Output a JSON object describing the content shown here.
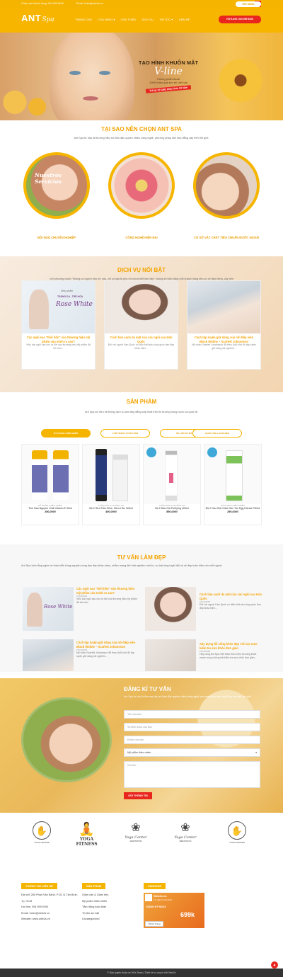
{
  "topbar": {
    "hotline_text": "Chăm sóc khách hàng: 094.999.9290",
    "email_text": "Email: hotro@web2s.vn"
  },
  "header": {
    "logo_main": "ANT",
    "logo_script": "Spa",
    "nav": [
      "TRANG CHỦ",
      "CỬA HÀNG ▾",
      "GIỚI THIỆU",
      "DỊCH VỤ",
      "TIN TỨC ▾",
      "LIÊN HỆ"
    ],
    "cart_label": "GIỎ HÀNG",
    "hotline_button": "HOTLINE: 094 999 9290"
  },
  "hero": {
    "title": "TẠO HÌNH KHUÔN MẶT",
    "script": "V-line",
    "line1": "Không phẫu thuật",
    "line2": "100% hiệu quả tức thì, trẻ hóa",
    "badge": "Trẻ lại 10 tuổi, hiệu hình 10 năm"
  },
  "why": {
    "title": "TẠI SAO NÊN CHỌN ANT SPA",
    "desc": "Ant Spa tự hào là thương hiệu số hiệu đặc quyền nhiều công nghệ, phương pháp làm đẹp đẳng cấp trên thế giới.",
    "items": [
      {
        "label": "ĐỘI NGŨ CHUYÊN NGHIỆP",
        "overlay": "Nuestros Servicios"
      },
      {
        "label": "CÔNG NGHỆ HIỆN ĐẠI"
      },
      {
        "label": "CƠ SỞ VẬT CHẤT TIÊU CHUẨN NƯỚC NGOÀI"
      }
    ]
  },
  "services": {
    "title": "DỊCH VỤ NỔI BẬT",
    "desc": "Với phương châm \"không có người phụ nữ xấu, chỉ có người phụ nữ chưa biết làm đẹp\" chúng tôi hiểu rằng mỗi khách hàng đều có vẻ đẹp riêng, vậy nên có một nhu cầu làm đẹp riêng",
    "cards": [
      {
        "title": "Các ngôi sao \"thổi hồn\" vào thương hiệu mỹ phẩm của mình ra sao?",
        "text": "Việc các ngôi sao cho ra đời các thương hiệu mỹ phẩm đã trở nên...",
        "img_line1": "Siêu phẩm",
        "img_line2": "TRẮNG DA - TRẺ HÓA",
        "img_script": "Rose White"
      },
      {
        "title": "Cách làm sạch da mặt của các ngôi sao Hàn Quốc",
        "text": "Đối với người Hàn Quốc có hiểu biết sâu rộng quốc làm đẹp khác hiện..."
      },
      {
        "title": "Cách tập luyện giữ dáng của nữ điệp viên Black Widow – Scarlett Johansson",
        "text": "Mỹ nhân Scarlett Johansson đã theo đuổi chế độ tập luyện giữ dáng rất nghiêm..."
      }
    ]
  },
  "products": {
    "title": "SẢN PHẨM",
    "desc": "Ant Spa sở hữu hệ thống dịch vụ làm đẹp đẳng cấp nhất trên thị trường trong nước và quốc tế.",
    "tabs": [
      "MỸ PHẨM THIÊN NHIÊN",
      "TẮM TRẮNG TOÀN THÂN",
      "TRỊ LIỆU DA MẶT",
      "GIẢM CÂN & GIẢM BÉO"
    ],
    "items": [
      {
        "cat": "MỸ PHẨM THIÊN NHIÊN",
        "name": "Tinh Dầu Nguyên Chất Vitamin E 30ml",
        "price": "250,000₫"
      },
      {
        "cat": "CHĂM SÓC & DƯỠNG DA",
        "name": "Bộ 2 Sữa Tắm Olive, Sữa & Bơ 400ml",
        "price": "400,000₫"
      },
      {
        "cat": "CHĂM SÓC & DƯỠNG DA",
        "name": "Bộ 2 Dầu Gội Purifying 400ml",
        "price": "550,000₫"
      },
      {
        "cat": "MỸ PHẨM THIÊN NHIÊN",
        "name": "Bộ 2 Dầu Gội Chăm Sóc Tóc Egg Extract 750ml",
        "price": "290,000₫"
      }
    ]
  },
  "advice": {
    "title": "TƯ VẤN LÀM ĐẸP",
    "desc": "Ant Spa luôn lắng nghe và thấu hiểu từng nguyện vọng làm đẹp khác nhau, nhằm mang đến trải nghiệm một tư, sự hài lòng tuyệt đối và vẻ đẹp toàn diện cho mỗi người.",
    "posts": [
      {
        "title": "Các ngôi sao \"thổi hồn\" vào thương hiệu mỹ phẩm của mình ra sao?",
        "date": "15/10/2018",
        "text": "Việc các ngôi sao cho ra đời các thương hiệu mỹ phẩm đã trở nên..."
      },
      {
        "title": "Cách làm sạch da mặt của các ngôi sao Hàn Quốc",
        "date": "15/10/2018",
        "text": "Đối với người Hàn Quốc có hiểu biết sâu rộng quốc làm đẹp khác hiện..."
      },
      {
        "title": "Cách tập luyện giữ dáng của nữ điệp viên Black Widow – Scarlett Johansson",
        "date": "15/10/2018",
        "text": "Mỹ nhân Scarlett Johansson đã theo đuổi chế độ tập luyện giữ dáng rất nghiêm..."
      },
      {
        "title": "Xây dựng lối sống khỏe đẹp với các mẹo kiểm tra sức khỏe đơn giản",
        "date": "15/10/2018",
        "text": "Hãy cùng Ant Spa Việt Nam thực hiện lối sống khỏe mạnh cùng những bài kiểm tra sức khỏe đơn giản..."
      }
    ]
  },
  "form": {
    "title": "ĐĂNG KÍ TƯ VẤN",
    "desc": "Ant Spa tự hào là thương hiệu số hiệu đặc quyền nhiều công nghệ, phương pháp làm đẹp đẳng cấp trên thế giới.",
    "name_ph": "Tên của bạn",
    "phone_ph": "Số điện thoại của bạn",
    "email_ph": "Email của bạn",
    "service_value": "Mỹ phẩm thiên nhiên",
    "note_ph": "Ghi chú",
    "submit": "GỬI THÔNG TIN"
  },
  "partners": [
    {
      "name": "YOGA CENTER",
      "icon": "hand-icon"
    },
    {
      "name": "YOGA FITNESS",
      "icon": "yoga-pose-icon"
    },
    {
      "name": "Yoga Center",
      "sub": "MEDITATION",
      "icon": "lotus-icon"
    },
    {
      "name": "Yoga Center",
      "sub": "MEDITATION",
      "icon": "lotus-icon"
    },
    {
      "name": "YOGA CENTER",
      "icon": "hand-icon"
    }
  ],
  "footer": {
    "contact_title": "THÔNG TIN LIÊN HỆ",
    "contact_lines": [
      "Địa chỉ: 265 Phan Văn Bảnh, P.15, Q.Tân Bình, Tp. HCM",
      "Hot line: 094 999 9290",
      "Email: hotro@web2s.vn",
      "Website: www.web2s.vn"
    ],
    "products_title": "SẢN PHẨM",
    "product_links": [
      "Giảm cân & Giảm béo",
      "Mỹ phẩm thiên nhiên",
      "Tắm trắng toàn thân",
      "Trị liệu da mặt",
      "Uncategorized"
    ],
    "fanpage_title": "FANPAGE",
    "fanpage_name": "Web2s.vn",
    "fanpage_likes": "1,5 nghìn lượt thích",
    "fanpage_tag": "ĐĂNG KÝ NGAY",
    "fanpage_promo": "699k",
    "fanpage_btn": "Thích Trang",
    "copyright": "© Bản quyền thuộc về W2s Team | Thiết kế và duy trì bởi Web2s"
  },
  "colors": {
    "accent": "#f5b400",
    "title": "#f5a300",
    "hotline": "#e8261e"
  }
}
